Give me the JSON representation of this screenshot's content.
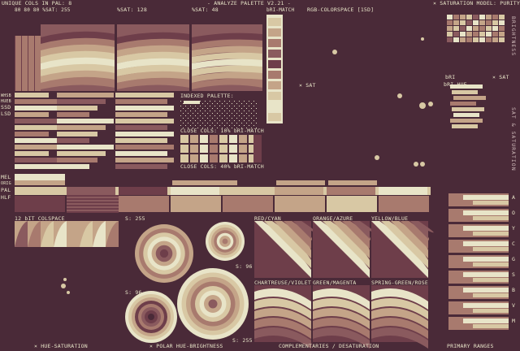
{
  "header": {
    "unique_cols": "UNIQUE COLS IN PAL: 8",
    "sub": "80 80 80 %SAT: 255",
    "xsat120": "%SAT: 128",
    "xsat48": "%SAT: 48",
    "title": "- ANALYZE PALETTE V2.21 -",
    "rgb": "RGB-COLORSPACE [15D]",
    "sat_model": "× SATURATION MODEL: PURITY"
  },
  "left_labels": {
    "rows": [
      "WHSB",
      "HUEB",
      "SSD",
      "LSD"
    ],
    "mel": [
      "MEL",
      "ORIG",
      "PAL",
      "HLF"
    ]
  },
  "indexed": {
    "title": "INDEXED PALETTE:",
    "close1": "CLOSE COLS: 10% bRI-MATCH",
    "close2": "CLOSE COLS: 40% bRI-MATCH"
  },
  "brimatch": "bRI-MATCH",
  "sat_marker": "× SAT",
  "bri_hue": "bRI-HUE",
  "bri": "bRI",
  "sat_right": "× SAT",
  "right_vertical": {
    "top": "BRIGHTNESS",
    "mid": "SAT & SATURATION"
  },
  "colspace": "12 bIT COLSPACE",
  "polar": {
    "s255a": "S: 255",
    "s96a": "S: 96",
    "s96b": "S: 96",
    "s255b": "S: 255"
  },
  "hue_panels": [
    "RED/CYAN",
    "ORANGE/AZURE",
    "YELLOW/BLUE",
    "CHARTREUSE/VIOLET",
    "GREEN/MAGENTA",
    "SPRING-GREEN/ROSE"
  ],
  "right_letters": [
    "A",
    "O",
    "Y",
    "C",
    "G",
    "S",
    "B",
    "V",
    "M"
  ],
  "footer": {
    "hs": "× HUE-SATURATION",
    "pb": "× POLAR HUE-BRIGHTNESS",
    "cd": "COMPLEMENTARIES / DESATURATION",
    "pr": "PRIMARY RANGES"
  },
  "palette": [
    "#4a2a38",
    "#6e3e4a",
    "#8a5a5e",
    "#a87a6e",
    "#c4a488",
    "#d8c8a4",
    "#e8e4c8",
    "#f4f2e0"
  ]
}
